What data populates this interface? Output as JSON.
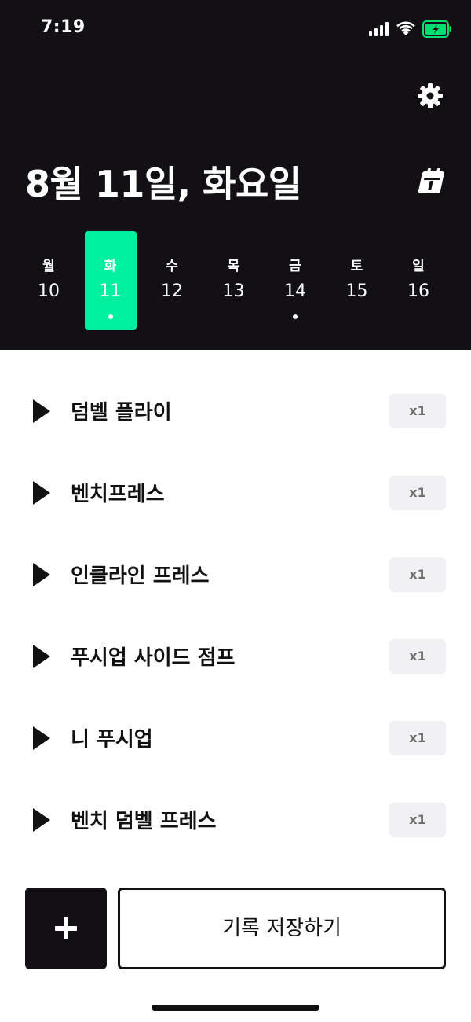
{
  "status_bar": {
    "time": "7:19"
  },
  "header": {
    "date_title": "8월 11일, 화요일",
    "settings_icon": "gear-icon",
    "calendar_icon": "calendar-icon"
  },
  "week": {
    "selected_index": 1,
    "accent_color": "#00f0a0",
    "days": [
      {
        "name": "월",
        "num": "10",
        "has_record": false
      },
      {
        "name": "화",
        "num": "11",
        "has_record": true
      },
      {
        "name": "수",
        "num": "12",
        "has_record": false
      },
      {
        "name": "목",
        "num": "13",
        "has_record": false
      },
      {
        "name": "금",
        "num": "14",
        "has_record": true
      },
      {
        "name": "토",
        "num": "15",
        "has_record": false
      },
      {
        "name": "일",
        "num": "16",
        "has_record": false
      }
    ]
  },
  "exercises": [
    {
      "name": "덤벨 플라이",
      "count": "x1"
    },
    {
      "name": "벤치프레스",
      "count": "x1"
    },
    {
      "name": "인클라인 프레스",
      "count": "x1"
    },
    {
      "name": "푸시업 사이드 점프",
      "count": "x1"
    },
    {
      "name": "니 푸시업",
      "count": "x1"
    },
    {
      "name": "벤치 덤벨 프레스",
      "count": "x1"
    }
  ],
  "footer": {
    "add_icon": "plus-icon",
    "save_label": "기록 저장하기"
  },
  "colors": {
    "header_bg": "#121015",
    "badge_bg": "#f1f0f2"
  }
}
